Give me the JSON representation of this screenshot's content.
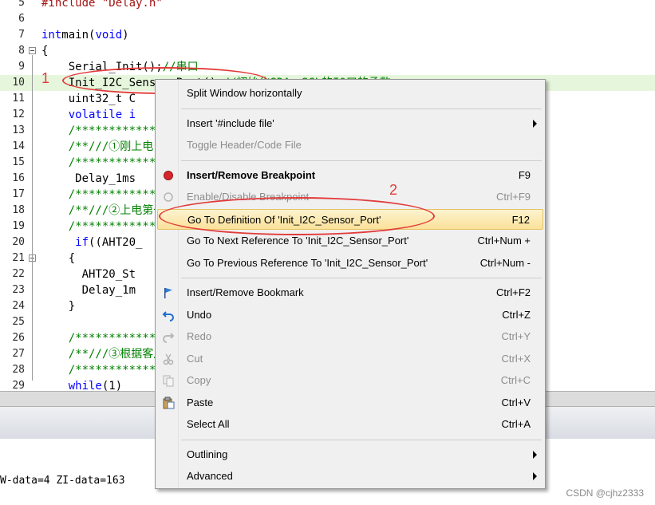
{
  "editor": {
    "lines": [
      {
        "n": "5",
        "parts": [
          [
            "str",
            "#include \"Delay.h\""
          ]
        ]
      },
      {
        "n": "6",
        "parts": []
      },
      {
        "n": "7",
        "parts": [
          [
            "kw",
            "int"
          ],
          [
            "",
            "main("
          ],
          [
            "kw",
            "void"
          ],
          [
            "",
            ")"
          ]
        ]
      },
      {
        "n": "8",
        "parts": [
          [
            "",
            "{"
          ]
        ]
      },
      {
        "n": "9",
        "parts": [
          [
            "",
            "    Serial_Init();"
          ],
          [
            "cmt",
            "//串口"
          ]
        ]
      },
      {
        "n": "10",
        "parts": [
          [
            "",
            "    Init_I2C_Sensor_Port();"
          ],
          [
            "cmt",
            "//初始化SDA、SCL的IO口的函数"
          ]
        ]
      },
      {
        "n": "11",
        "parts": [
          [
            "",
            "    uint32_t C"
          ]
        ]
      },
      {
        "n": "12",
        "parts": [
          [
            "",
            "    "
          ],
          [
            "kw",
            "volatile"
          ],
          [
            "",
            ""
          ],
          [
            "kw",
            " i"
          ]
        ]
      },
      {
        "n": "13",
        "parts": [
          [
            "cmt",
            "    /*********************************************************************"
          ]
        ]
      },
      {
        "n": "14",
        "parts": [
          [
            "cmt",
            "    /**///①刚上电，产品芯片内部就绪需要时间，延时100~500ms，建议500ms"
          ]
        ]
      },
      {
        "n": "15",
        "parts": [
          [
            "cmt",
            "    /*********************************************************************"
          ]
        ]
      },
      {
        "n": "16",
        "parts": [
          [
            "",
            "     Delay_1ms"
          ]
        ]
      },
      {
        "n": "17",
        "parts": [
          [
            "cmt",
            "    /*********************************************************************"
          ]
        ]
      },
      {
        "n": "18",
        "parts": [
          [
            "cmt",
            "    /**///②上电第一次发0x71读取状态字，判断状态字是否为0x18,如果不是0x18,进行"
          ]
        ]
      },
      {
        "n": "19",
        "parts": [
          [
            "cmt",
            "    /*********************************************************************"
          ]
        ]
      },
      {
        "n": "20",
        "parts": [
          [
            "",
            "     "
          ],
          [
            "kw",
            "if"
          ],
          [
            "",
            "((AHT20_"
          ]
        ]
      },
      {
        "n": "21",
        "parts": [
          [
            "",
            "    {"
          ]
        ]
      },
      {
        "n": "22",
        "parts": [
          [
            "",
            "      AHT20_St"
          ]
        ]
      },
      {
        "n": "23",
        "parts": [
          [
            "",
            "      Delay_1m"
          ]
        ]
      },
      {
        "n": "24",
        "parts": [
          [
            "",
            "    }"
          ]
        ]
      },
      {
        "n": "25",
        "parts": []
      },
      {
        "n": "26",
        "parts": [
          [
            "cmt",
            "    /*********************************************************************"
          ]
        ]
      },
      {
        "n": "27",
        "parts": [
          [
            "cmt",
            "    /**///③根据客户自己需求发测量命令读取温湿度数据，当前while(1)循环发测量"
          ]
        ]
      },
      {
        "n": "28",
        "parts": [
          [
            "cmt",
            "    /*********************************************************************"
          ]
        ]
      },
      {
        "n": "29",
        "parts": [
          [
            "",
            "    "
          ],
          [
            "kw",
            "while"
          ],
          [
            "",
            "(1)"
          ]
        ]
      }
    ]
  },
  "build_output": {
    "line": "W-data=4 ZI-data=163"
  },
  "annotations": {
    "label_1": "1",
    "label_2": "2",
    "accent": "#e23b3b"
  },
  "context_menu": {
    "items": [
      {
        "label": "Split Window horizontally",
        "shortcut": "",
        "icon": "",
        "disabled": false,
        "bold": false
      },
      {
        "sep": true
      },
      {
        "label": "Insert '#include file'",
        "shortcut": "",
        "icon": "",
        "submenu": true
      },
      {
        "label": "Toggle Header/Code File",
        "shortcut": "",
        "icon": "",
        "disabled": true
      },
      {
        "sep": true
      },
      {
        "label": "Insert/Remove Breakpoint",
        "shortcut": "F9",
        "icon": "breakpoint-icon",
        "bold": true
      },
      {
        "label": "Enable/Disable Breakpoint",
        "shortcut": "Ctrl+F9",
        "icon": "breakpoint-outline-icon",
        "disabled": true
      },
      {
        "label": "Go To Definition Of 'Init_I2C_Sensor_Port'",
        "shortcut": "F12",
        "icon": "",
        "selected": true
      },
      {
        "label": "Go To Next Reference To 'Init_I2C_Sensor_Port'",
        "shortcut": "Ctrl+Num +",
        "icon": ""
      },
      {
        "label": "Go To Previous Reference To 'Init_I2C_Sensor_Port'",
        "shortcut": "Ctrl+Num -",
        "icon": ""
      },
      {
        "sep": true
      },
      {
        "label": "Insert/Remove Bookmark",
        "shortcut": "Ctrl+F2",
        "icon": "bookmark-flag-icon"
      },
      {
        "label": "Undo",
        "shortcut": "Ctrl+Z",
        "icon": "undo-icon"
      },
      {
        "label": "Redo",
        "shortcut": "Ctrl+Y",
        "icon": "redo-icon",
        "disabled": true
      },
      {
        "label": "Cut",
        "shortcut": "Ctrl+X",
        "icon": "cut-icon",
        "disabled": true
      },
      {
        "label": "Copy",
        "shortcut": "Ctrl+C",
        "icon": "copy-icon",
        "disabled": true
      },
      {
        "label": "Paste",
        "shortcut": "Ctrl+V",
        "icon": "paste-icon"
      },
      {
        "label": "Select All",
        "shortcut": "Ctrl+A",
        "icon": ""
      },
      {
        "sep": true
      },
      {
        "label": "Outlining",
        "shortcut": "",
        "icon": "",
        "submenu": true
      },
      {
        "label": "Advanced",
        "shortcut": "",
        "icon": "",
        "submenu": true
      }
    ]
  },
  "watermark": "CSDN @cjhz2333"
}
